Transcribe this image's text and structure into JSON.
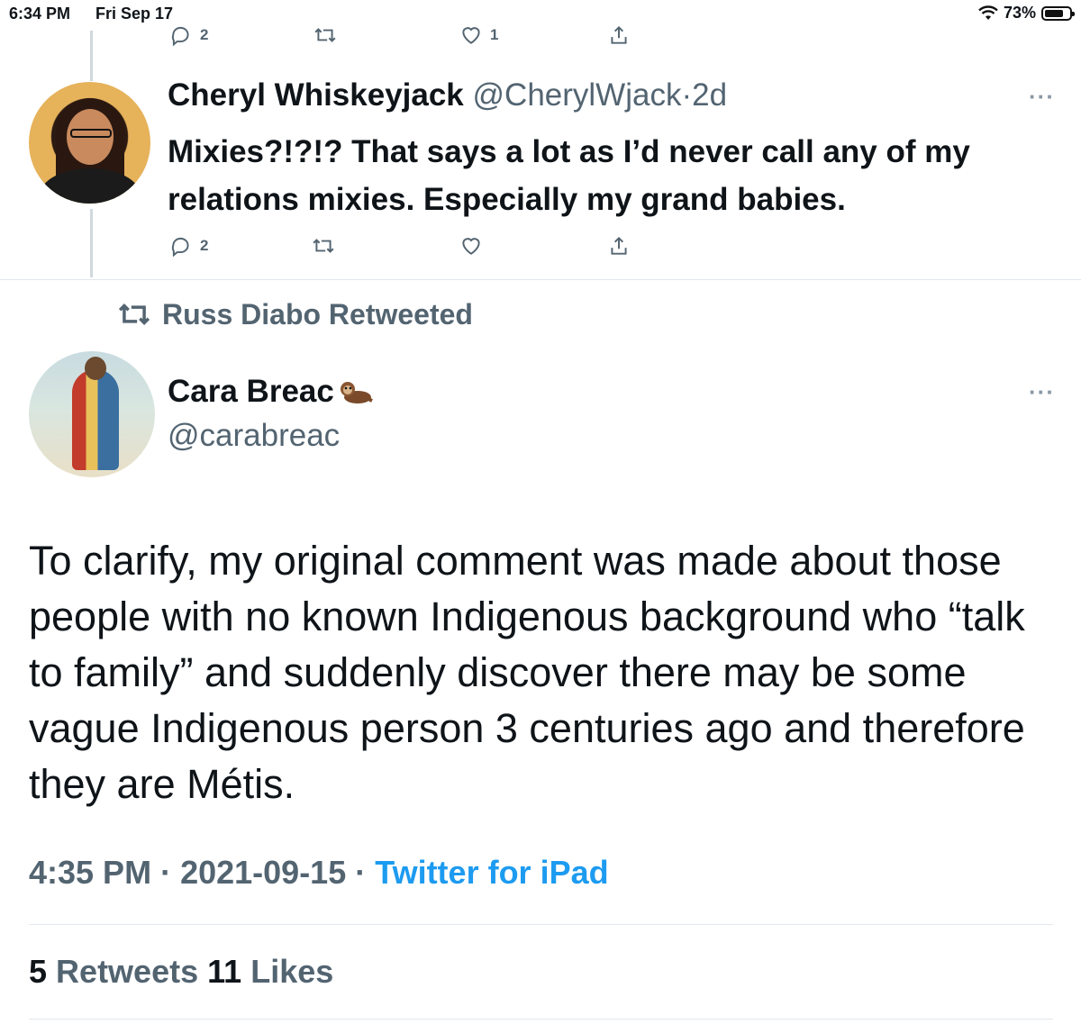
{
  "status_bar": {
    "time": "6:34 PM",
    "date": "Fri Sep 17",
    "battery": "73%",
    "battery_level": 0.73
  },
  "prev_tweet_actions": {
    "replies": "2",
    "retweets": "",
    "likes": "1"
  },
  "reply_tweet": {
    "name": "Cheryl Whiskeyjack",
    "handle": "@CherylWjack",
    "age": "·2d",
    "text": "Mixies?!?!? That says a lot as I’d never call any of my relations mixies. Especially my grand babies.",
    "replies": "2",
    "retweets": "",
    "likes": ""
  },
  "retweet_banner": "Russ Diabo Retweeted",
  "main_tweet": {
    "name": "Cara Breac",
    "handle": "@carabreac",
    "text": "To clarify, my original comment was made about those people with no known Indigenous background who “talk to family” and suddenly discover there may be some vague Indigenous person 3 centuries ago and therefore they are Métis.",
    "time": "4:35 PM",
    "date": "2021-09-15",
    "source": "Twitter for iPad",
    "retweet_count": "5",
    "retweet_label": "Retweets",
    "like_count": "11",
    "like_label": "Likes"
  },
  "icons": [
    "reply-icon",
    "retweet-icon",
    "like-icon",
    "share-icon",
    "more-icon",
    "wifi-icon",
    "battery-icon",
    "otter-emoji"
  ]
}
